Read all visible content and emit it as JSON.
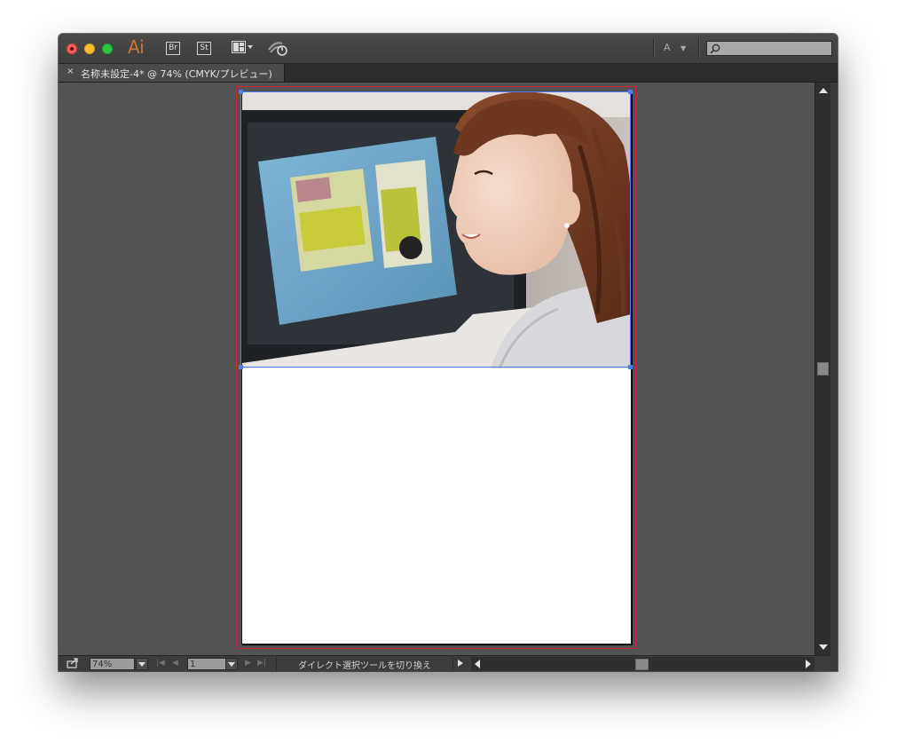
{
  "app": {
    "logo_text": "Ai",
    "bridge_label": "Br",
    "stock_label": "St",
    "workspace_label": "A",
    "search": {
      "value": ""
    }
  },
  "document_tab": {
    "close_glyph": "×",
    "title": "名称未設定-4* @ 74% (CMYK/プレビュー)"
  },
  "statusbar": {
    "zoom": "74%",
    "page": "1",
    "tool_status": "ダイレクト選択ツールを切り換え"
  },
  "placed_image": {
    "description": "photo"
  },
  "colors": {
    "accent_logo": "#c9743a",
    "bleed_guide": "#d2242e",
    "selection": "#4e7cf5",
    "canvas_bg": "#535353"
  }
}
